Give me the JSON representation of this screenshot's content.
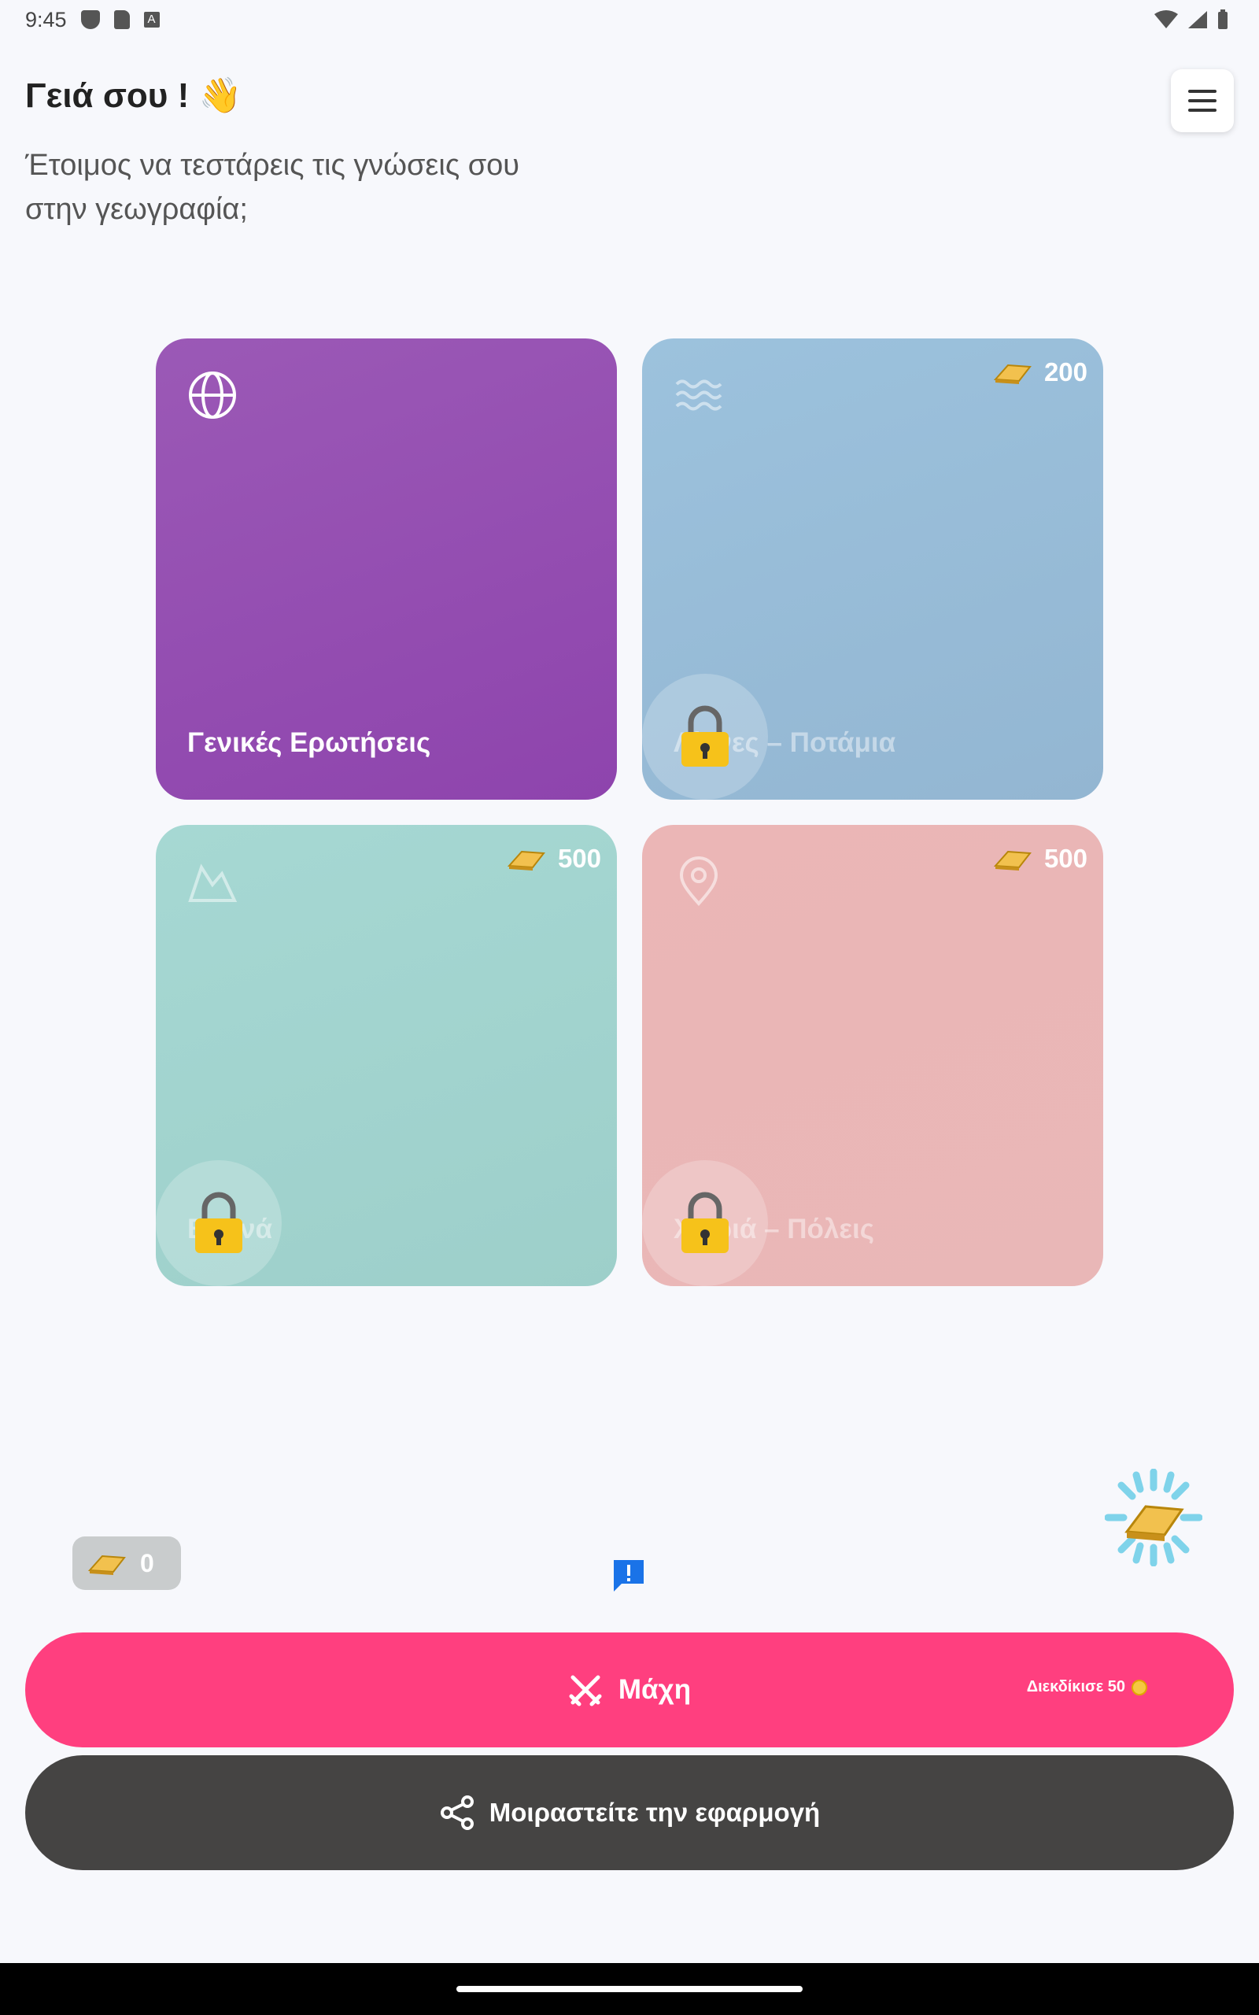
{
  "status_bar": {
    "time": "9:45",
    "icons": [
      "shield-icon",
      "sd-card-icon",
      "a-icon"
    ],
    "right_icons": [
      "wifi-icon",
      "signal-icon",
      "battery-icon"
    ]
  },
  "header": {
    "greeting": "Γειά σου ! 👋",
    "subtitle": "Έτοιμος να τεστάρεις τις γνώσεις σου στην γεωγραφία;",
    "menu_icon": "menu-icon"
  },
  "categories": [
    {
      "title": "Γενικές Ερωτήσεις",
      "icon": "globe-icon",
      "locked": false,
      "color": "#9b59b6"
    },
    {
      "title": "Λίμνες – Ποτάμια",
      "icon": "waves-icon",
      "locked": true,
      "price": "200",
      "color": "#9cc2dd"
    },
    {
      "title": "Βουνά",
      "icon": "mountain-icon",
      "locked": true,
      "price": "500",
      "color": "#a6d8d3"
    },
    {
      "title": "Χωριά – Πόλεις",
      "icon": "location-pin-icon",
      "locked": true,
      "price": "500",
      "color": "#ebb6b6"
    }
  ],
  "wallet": {
    "balance": "0"
  },
  "battle": {
    "label": "Μάχη",
    "claim": "Διεκδίκισε 50",
    "color": "#ff3f7f"
  },
  "share": {
    "label": "Μοιραστείτε την εφαρμογή",
    "color": "#454443"
  }
}
